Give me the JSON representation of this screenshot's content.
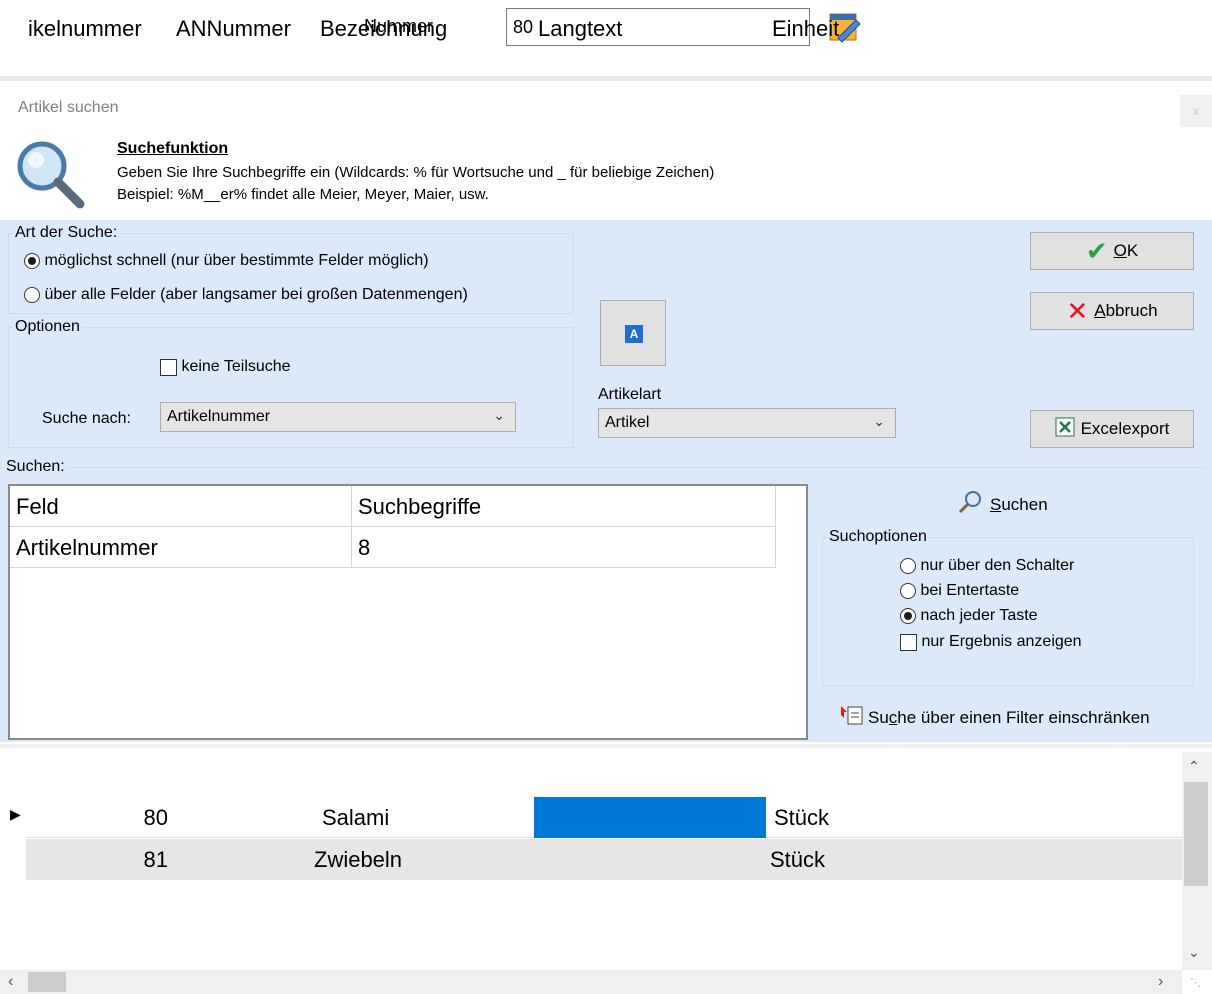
{
  "top": {
    "label": "Nummer",
    "value": "80"
  },
  "dialog": {
    "title": "Artikel suchen",
    "close": "x",
    "hint_title": "Suchefunktion",
    "hint_line1": "Geben Sie Ihre Suchbegriffe ein (Wildcards: % für Wortsuche und _ für beliebige Zeichen)",
    "hint_line2": "Beispiel: %M__er% findet alle Meier, Meyer, Maier, usw."
  },
  "art_der_suche": {
    "legend": "Art der Suche:",
    "option1": "möglichst schnell (nur über bestimmte Felder möglich)",
    "option2": "über alle Felder (aber langsamer bei großen Datenmengen)",
    "selected": "option1"
  },
  "optionen": {
    "legend": "Optionen",
    "keine_teilsuche": "keine Teilsuche",
    "suche_nach_label": "Suche nach:",
    "suche_nach_value": "Artikelnummer"
  },
  "artikelart": {
    "label": "Artikelart",
    "value": "Artikel"
  },
  "buttons": {
    "ok_prefix": "",
    "ok_underlined": "O",
    "ok_rest": "K",
    "abbruch_underlined": "A",
    "abbruch_rest": "bbruch",
    "excel": "Excelexport"
  },
  "suchen": {
    "legend": "Suchen:",
    "columns": [
      "Feld",
      "Suchbegriffe"
    ],
    "rows": [
      [
        "Artikelnummer",
        "8"
      ]
    ],
    "search_underlined": "S",
    "search_rest": "uchen",
    "suchoptionen_legend": "Suchoptionen",
    "opt1": "nur über den Schalter",
    "opt2": "bei Entertaste",
    "opt3": "nach jeder Taste",
    "opt4": "nur Ergebnis anzeigen",
    "filter_pre": "Su",
    "filter_u": "c",
    "filter_post": "he über einen Filter einschränken"
  },
  "results": {
    "columns": [
      "ikelnummer",
      "ANNummer",
      "Bezeichnung",
      "Langtext",
      "Einheit"
    ],
    "rows": [
      [
        "80",
        "",
        "Salami",
        "",
        "Stück"
      ],
      [
        "81",
        "",
        "Zwiebeln",
        "",
        "Stück"
      ]
    ]
  },
  "colors": {
    "panel": "#dbe9fa",
    "selection": "#0078d7",
    "ok_check": "#2ea043",
    "cancel_x": "#e81123"
  }
}
